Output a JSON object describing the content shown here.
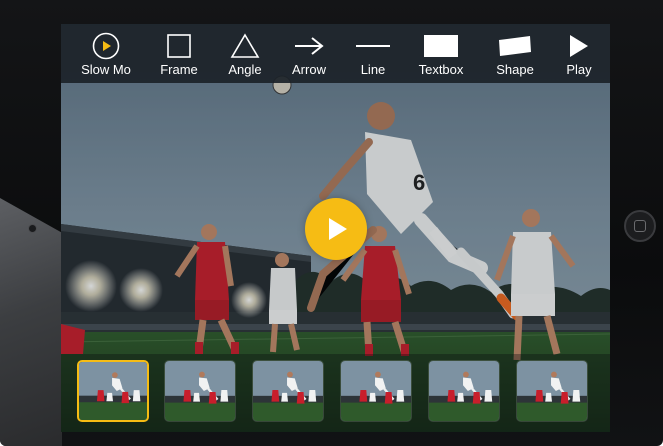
{
  "toolbar": {
    "tools": [
      {
        "label": "Slow Mo",
        "icon": "slow-mo-icon"
      },
      {
        "label": "Frame",
        "icon": "frame-icon"
      },
      {
        "label": "Angle",
        "icon": "angle-icon"
      },
      {
        "label": "Arrow",
        "icon": "arrow-icon"
      },
      {
        "label": "Line",
        "icon": "line-icon"
      },
      {
        "label": "Textbox",
        "icon": "textbox-icon"
      },
      {
        "label": "Shape",
        "icon": "shape-icon"
      },
      {
        "label": "Play",
        "icon": "play-icon"
      }
    ]
  },
  "player": {
    "center_control": "play-icon"
  },
  "filmstrip": {
    "frame_count": 6,
    "selected_frame": 1
  },
  "colors": {
    "accent": "#f6bc14",
    "toolbar_bg": "#1c2229",
    "toolbar_text": "#ffffff",
    "home_kit": "#c81e2b",
    "away_kit": "#ffffff"
  }
}
